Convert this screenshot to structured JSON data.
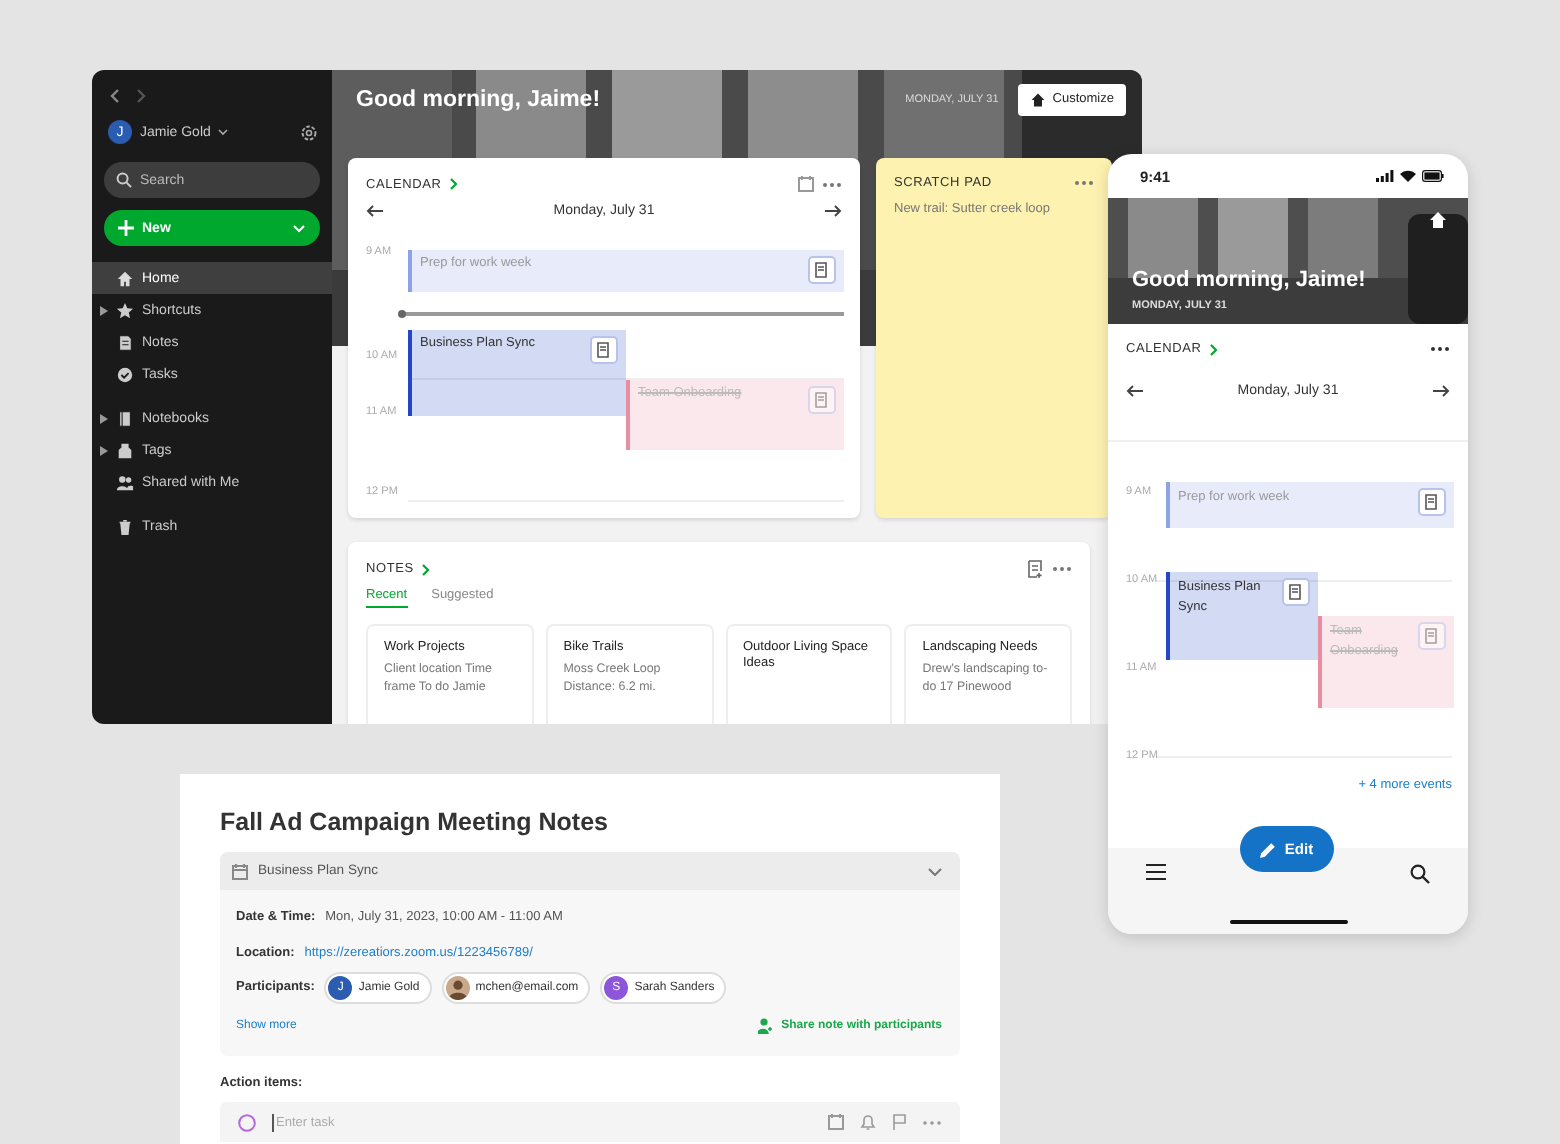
{
  "desktop": {
    "sidebar": {
      "user": {
        "initial": "J",
        "name": "Jamie Gold"
      },
      "search": {
        "placeholder": "Search"
      },
      "new_button": "New",
      "items": [
        {
          "label": "Home",
          "selected": true,
          "expandable": false
        },
        {
          "label": "Shortcuts",
          "selected": false,
          "expandable": true
        },
        {
          "label": "Notes",
          "selected": false,
          "expandable": false
        },
        {
          "label": "Tasks",
          "selected": false,
          "expandable": false
        },
        {
          "label": "Notebooks",
          "selected": false,
          "expandable": true
        },
        {
          "label": "Tags",
          "selected": false,
          "expandable": true
        },
        {
          "label": "Shared with Me",
          "selected": false,
          "expandable": false
        },
        {
          "label": "Trash",
          "selected": false,
          "expandable": false
        }
      ]
    },
    "greeting": "Good morning, Jaime!",
    "date": "MONDAY, JULY 31",
    "customize_button": "Customize",
    "calendar": {
      "title": "CALENDAR",
      "date": "Monday, July 31",
      "hours": [
        "9 AM",
        "10 AM",
        "11 AM",
        "12 PM"
      ],
      "events": [
        {
          "title": "Prep for work week",
          "kind": "past",
          "color": "#8ea2e6"
        },
        {
          "title": "Business Plan Sync",
          "kind": "current",
          "color": "#2447c9"
        },
        {
          "title": "Team Onboarding",
          "kind": "declined",
          "color": "#e98ea0"
        }
      ]
    },
    "scratch_pad": {
      "title": "SCRATCH PAD",
      "text": "New trail: Sutter creek loop"
    },
    "notes": {
      "title": "NOTES",
      "tabs": [
        {
          "label": "Recent",
          "selected": true
        },
        {
          "label": "Suggested",
          "selected": false
        }
      ],
      "cards": [
        {
          "title": "Work Projects",
          "snippet": "Client location Time frame To do Jamie"
        },
        {
          "title": "Bike Trails",
          "snippet": "Moss Creek Loop Distance: 6.2 mi."
        },
        {
          "title": "Outdoor Living Space Ideas"
        },
        {
          "title": "Landscaping Needs",
          "snippet": "Drew's landscaping to-do 17 Pinewood"
        }
      ]
    }
  },
  "phone": {
    "time": "9:41",
    "greeting": "Good morning, Jaime!",
    "date": "MONDAY, JULY 31",
    "calendar": {
      "title": "CALENDAR",
      "date": "Monday, July 31",
      "hours": [
        "9 AM",
        "10 AM",
        "11 AM",
        "12 PM"
      ],
      "events": [
        {
          "title": "Prep for work week",
          "kind": "past",
          "color": "#8ea2e6"
        },
        {
          "title": "Business Plan Sync",
          "kind": "current",
          "color": "#2447c9"
        },
        {
          "title": "Team Onboarding",
          "kind": "declined",
          "color": "#e98ea0"
        }
      ]
    },
    "more_events": "+ 4 more events",
    "edit_button": "Edit"
  },
  "note_doc": {
    "title": "Fall Ad Campaign Meeting Notes",
    "event": "Business Plan Sync",
    "date_label": "Date & Time:",
    "date_value": "Mon, July 31, 2023, 10:00 AM - 11:00 AM",
    "location_label": "Location:",
    "location": "https://zereatiors.zoom.us/1223456789/",
    "participants_label": "Participants:",
    "participants": [
      {
        "kind": "initial",
        "initial": "J",
        "name": "Jamie Gold",
        "color": "#2a5db0"
      },
      {
        "name": "mchen@email.com"
      },
      {
        "kind": "initial",
        "initial": "S",
        "name": "Sarah Sanders",
        "color": "#8d55d9"
      }
    ],
    "show_more": "Show more",
    "share": "Share note with participants",
    "action_label": "Action items:",
    "task_placeholder": "Enter task"
  }
}
